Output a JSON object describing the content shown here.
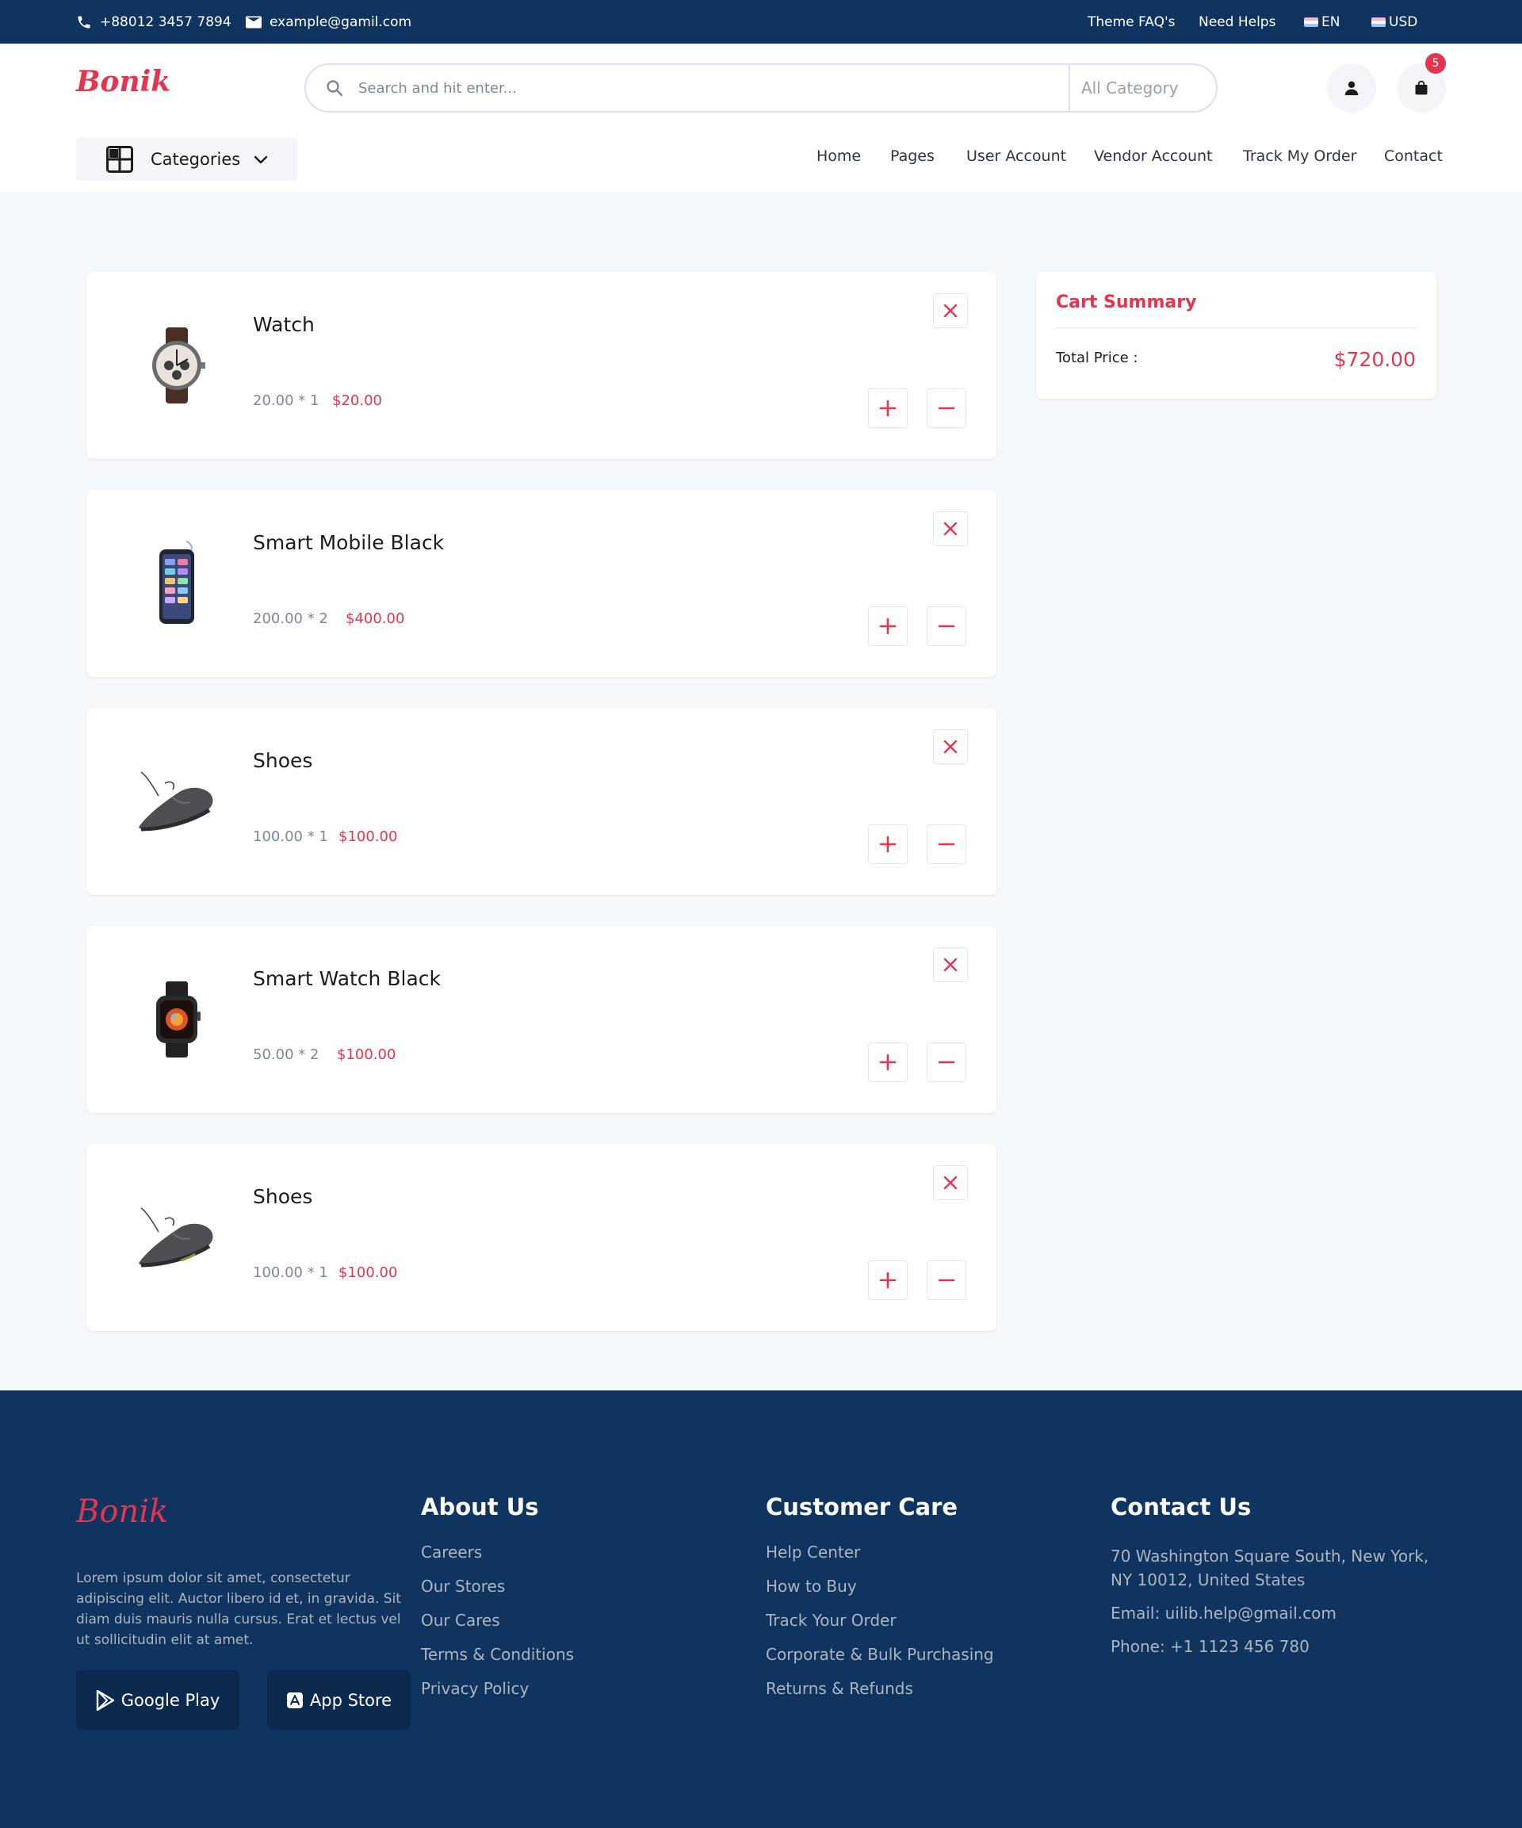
{
  "topbar": {
    "phone": "+88012 3457 7894",
    "email": "example@gamil.com",
    "faq": "Theme FAQ's",
    "help": "Need Helps",
    "language": "EN",
    "currency": "USD"
  },
  "header": {
    "logo": "Bonik",
    "search_placeholder": "Search and hit enter...",
    "category_select": "All Category",
    "cart_count": "5",
    "categories_label": "Categories"
  },
  "nav": [
    "Home",
    "Pages",
    "User Account",
    "Vendor Account",
    "Track My Order",
    "Contact"
  ],
  "cart": {
    "items": [
      {
        "name": "Watch",
        "qty": "20.00 * 1",
        "total": "$20.00",
        "image": "watch-image"
      },
      {
        "name": "Smart Mobile Black",
        "qty": "200.00 * 2",
        "total": "$400.00",
        "image": "mobile-image"
      },
      {
        "name": "Shoes",
        "qty": "100.00 * 1",
        "total": "$100.00",
        "image": "shoes-image"
      },
      {
        "name": "Smart Watch Black",
        "qty": "50.00 * 2",
        "total": "$100.00",
        "image": "smartwatch-image"
      },
      {
        "name": "Shoes",
        "qty": "100.00 * 1",
        "total": "$100.00",
        "image": "shoes-image"
      }
    ]
  },
  "summary": {
    "title": "Cart Summary",
    "total_label": "Total Price :",
    "total_value": "$720.00"
  },
  "footer": {
    "logo": "Bonik",
    "description": "Lorem ipsum dolor sit amet, consectetur adipiscing elit. Auctor libero id et, in gravida. Sit diam duis mauris nulla cursus. Erat et lectus vel ut sollicitudin elit at amet.",
    "google_play": "Google Play",
    "app_store": "App Store",
    "about": {
      "title": "About Us",
      "links": [
        "Careers",
        "Our Stores",
        "Our Cares",
        "Terms & Conditions",
        "Privacy Policy"
      ]
    },
    "care": {
      "title": "Customer Care",
      "links": [
        "Help Center",
        "How to Buy",
        "Track Your Order",
        "Corporate & Bulk Purchasing",
        "Returns & Refunds"
      ]
    },
    "contact": {
      "title": "Contact Us",
      "address": "70 Washington Square South, New York, NY 10012, United States",
      "email": "Email: uilib.help@gmail.com",
      "phone": "Phone: +1 1123 456 780"
    }
  },
  "colors": {
    "navy": "#0f3460",
    "accent": "#e3364e",
    "page_bg": "#f6f9fc"
  }
}
